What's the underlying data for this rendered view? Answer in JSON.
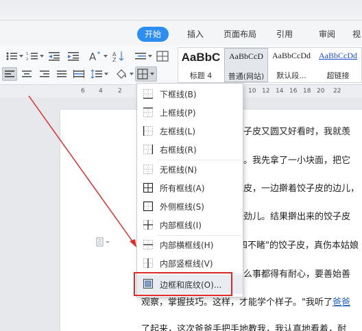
{
  "tabs": [
    "开始",
    "插入",
    "页面布局",
    "引用",
    "审阅",
    "视"
  ],
  "styles": [
    {
      "preview": "AaBbC",
      "label": "标题 4"
    },
    {
      "preview": "AaBbCcD",
      "label": "普通(网站)"
    },
    {
      "preview": "AaBbCcDd",
      "label": "默认段..."
    },
    {
      "preview": "AaBbCcDd",
      "label": "超链接"
    }
  ],
  "ruler": [
    "6",
    "4",
    "2",
    "10",
    "12",
    "14",
    "16",
    "18",
    "20",
    "22"
  ],
  "menu": [
    {
      "label": "下框线(B)",
      "icon": "border-bottom-icon"
    },
    {
      "label": "上框线(P)",
      "icon": "border-top-icon"
    },
    {
      "label": "左框线(L)",
      "icon": "border-left-icon"
    },
    {
      "label": "右框线(R)",
      "icon": "border-right-icon"
    },
    {
      "label": "无框线(N)",
      "icon": "border-none-icon"
    },
    {
      "label": "所有框线(A)",
      "icon": "border-all-icon"
    },
    {
      "label": "外侧框线(S)",
      "icon": "border-outside-icon"
    },
    {
      "label": "内部框线(I)",
      "icon": "border-inside-icon"
    },
    {
      "label": "内部横框线(H)",
      "icon": "border-inside-horizontal-icon"
    },
    {
      "label": "内部竖框线(V)",
      "icon": "border-inside-vertical-icon"
    },
    {
      "label": "边框和底纹(O)...",
      "icon": "borders-and-shading-icon"
    }
  ],
  "document": {
    "lines": [
      "饺子皮又圆又好看时，我就羡",
      "皮。我先拿了一小块面，把它",
      "子皮，一边擀着饺子皮的边儿，",
      "使劲儿。结果擀出来的饺子皮",
      "\"四不睹\"的饺子皮，真伤本姑娘",
      "什么事都得有耐心，要善始善",
      "观察，掌握技巧。这样，才能学个样子。\"我听了",
      "了起来，这次爸爸手把手地教我，我认真地看着，耐"
    ],
    "link_text": "爸爸"
  },
  "colors": {
    "accent": "#2d8df0",
    "highlight_box": "#e02a2a",
    "link": "#2060c0"
  }
}
